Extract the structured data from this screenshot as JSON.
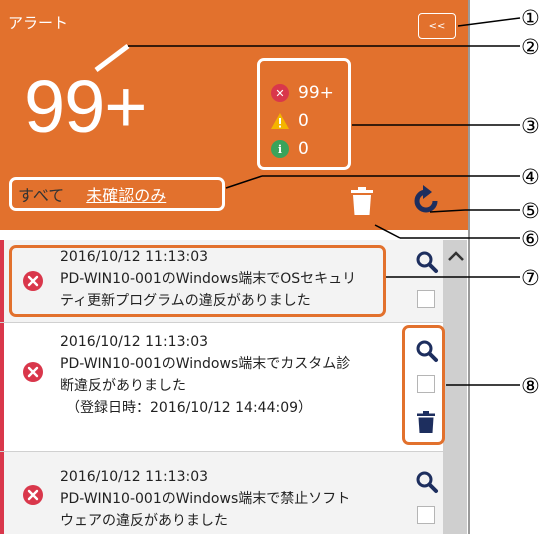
{
  "panel": {
    "title": "アラート",
    "collapse_label": "<<",
    "total": "99+"
  },
  "counts": {
    "error": "99+",
    "warning": "0",
    "info": "0"
  },
  "filters": {
    "all": "すべて",
    "unread": "未確認のみ"
  },
  "alerts": [
    {
      "time": "2016/10/12 11:13:03",
      "line1": "PD-WIN10-001のWindows端末でOSセキュリ",
      "line2": "ティ更新プログラムの違反がありました",
      "line3": ""
    },
    {
      "time": "2016/10/12 11:13:03",
      "line1": "PD-WIN10-001のWindows端末でカスタム診",
      "line2": "断違反がありました",
      "line3": "（登録日時：2016/10/12 14:44:09）"
    },
    {
      "time": "2016/10/12 11:13:03",
      "line1": "PD-WIN10-001のWindows端末で禁止ソフト",
      "line2": "ウェアの違反がありました",
      "line3": ""
    }
  ],
  "callouts": [
    "①",
    "②",
    "③",
    "④",
    "⑤",
    "⑥",
    "⑦",
    "⑧"
  ],
  "colors": {
    "header": "#e2712d",
    "error": "#d9374b",
    "warning": "#f4b400",
    "info": "#3aa35a",
    "icon_dark": "#1d2e5e"
  }
}
